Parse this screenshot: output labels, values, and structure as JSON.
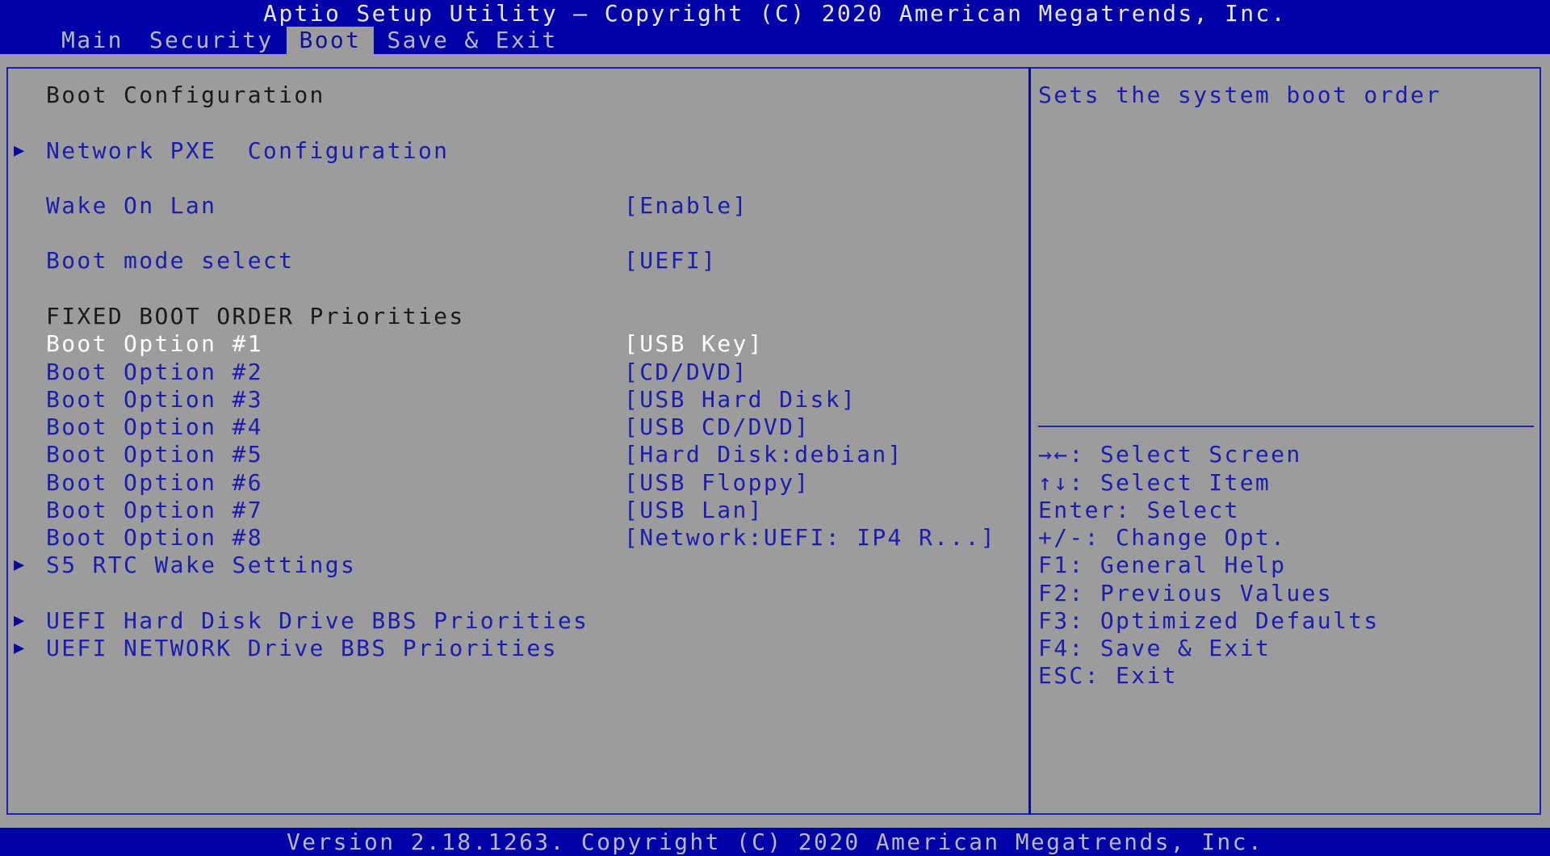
{
  "header": {
    "title": "Aptio Setup Utility – Copyright (C) 2020 American Megatrends, Inc.",
    "tabs": [
      {
        "label": "Main",
        "active": false
      },
      {
        "label": "Security",
        "active": false
      },
      {
        "label": "Boot",
        "active": true
      },
      {
        "label": "Save & Exit",
        "active": false
      }
    ]
  },
  "main": {
    "section_title": "Boot Configuration",
    "submenus": {
      "network_pxe": "Network PXE  Configuration",
      "s5_rtc": "S5 RTC Wake Settings",
      "uefi_hdd_bbs": "UEFI Hard Disk Drive BBS Priorities",
      "uefi_network_bbs": "UEFI NETWORK Drive BBS Priorities"
    },
    "settings": {
      "wake_on_lan": {
        "label": "Wake On Lan",
        "value": "[Enable]"
      },
      "boot_mode": {
        "label": "Boot mode select",
        "value": "[UEFI]"
      }
    },
    "fixed_boot_order_title": "FIXED BOOT ORDER Priorities",
    "boot_options": [
      {
        "label": "Boot Option #1",
        "value": "[USB Key]",
        "selected": true
      },
      {
        "label": "Boot Option #2",
        "value": "[CD/DVD]"
      },
      {
        "label": "Boot Option #3",
        "value": "[USB Hard Disk]"
      },
      {
        "label": "Boot Option #4",
        "value": "[USB CD/DVD]"
      },
      {
        "label": "Boot Option #5",
        "value": "[Hard Disk:debian]"
      },
      {
        "label": "Boot Option #6",
        "value": "[USB Floppy]"
      },
      {
        "label": "Boot Option #7",
        "value": "[USB Lan]"
      },
      {
        "label": "Boot Option #8",
        "value": "[Network:UEFI: IP4 R...]"
      }
    ],
    "submenu_arrow_icon": "▶"
  },
  "help_panel": {
    "description": "Sets the system boot order",
    "keys": [
      "→←: Select Screen",
      "↑↓: Select Item",
      "Enter: Select",
      "+/-: Change Opt.",
      "F1: General Help",
      "F2: Previous Values",
      "F3: Optimized Defaults",
      "F4: Save & Exit",
      "ESC: Exit"
    ]
  },
  "footer": {
    "text": "Version 2.18.1263. Copyright (C) 2020 American Megatrends, Inc."
  }
}
